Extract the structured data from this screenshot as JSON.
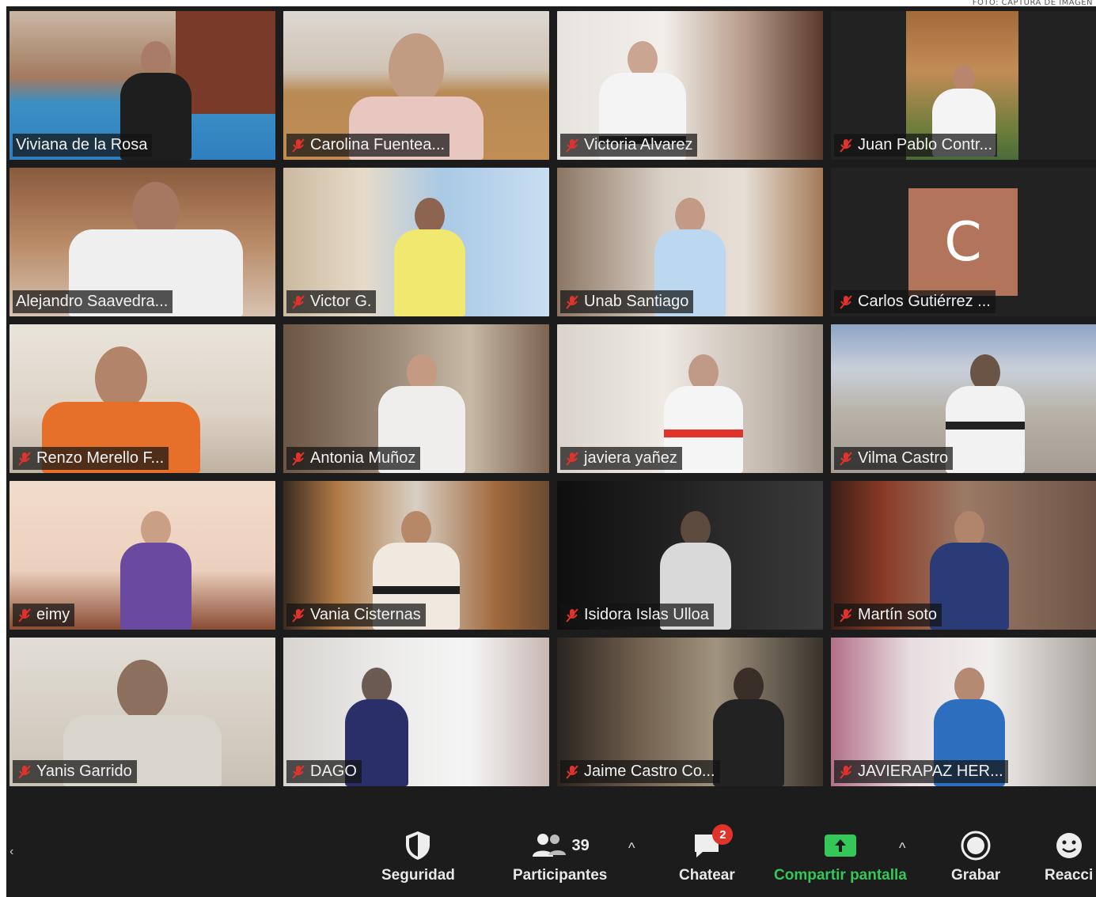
{
  "credit": "FOTO: CAPTURA DE IMAGEN",
  "participants_tiles": [
    {
      "name": "Viviana de la Rosa",
      "muted": false
    },
    {
      "name": "Carolina Fuentea...",
      "muted": true
    },
    {
      "name": "Victoria Alvarez",
      "muted": true
    },
    {
      "name": "Juan Pablo Contr...",
      "muted": true
    },
    {
      "name": "Alejandro Saavedra...",
      "muted": false
    },
    {
      "name": "Victor G.",
      "muted": true
    },
    {
      "name": "Unab Santiago",
      "muted": true
    },
    {
      "name": "Carlos Gutiérrez ...",
      "muted": true,
      "avatar_letter": "C"
    },
    {
      "name": "Renzo Merello F...",
      "muted": true
    },
    {
      "name": "Antonia Muñoz",
      "muted": true
    },
    {
      "name": "javiera yañez",
      "muted": true
    },
    {
      "name": "Vilma Castro",
      "muted": true
    },
    {
      "name": "eimy",
      "muted": true
    },
    {
      "name": "Vania Cisternas",
      "muted": true
    },
    {
      "name": "Isidora Islas Ulloa",
      "muted": true
    },
    {
      "name": "Martín soto",
      "muted": true
    },
    {
      "name": "Yanis Garrido",
      "muted": true
    },
    {
      "name": "DAGO",
      "muted": true
    },
    {
      "name": "Jaime Castro Co...",
      "muted": true
    },
    {
      "name": "JAVIERAPAZ HER...",
      "muted": true
    }
  ],
  "toolbar": {
    "security_label": "Seguridad",
    "participants_label": "Participantes",
    "participants_count": "39",
    "chat_label": "Chatear",
    "chat_badge": "2",
    "share_label": "Compartir pantalla",
    "record_label": "Grabar",
    "reactions_label": "Reacci"
  },
  "colors": {
    "active_speaker": "#f3e37a",
    "mute_red": "#e0332b",
    "share_green": "#35c758",
    "avatar_bg": "#b2755c"
  }
}
